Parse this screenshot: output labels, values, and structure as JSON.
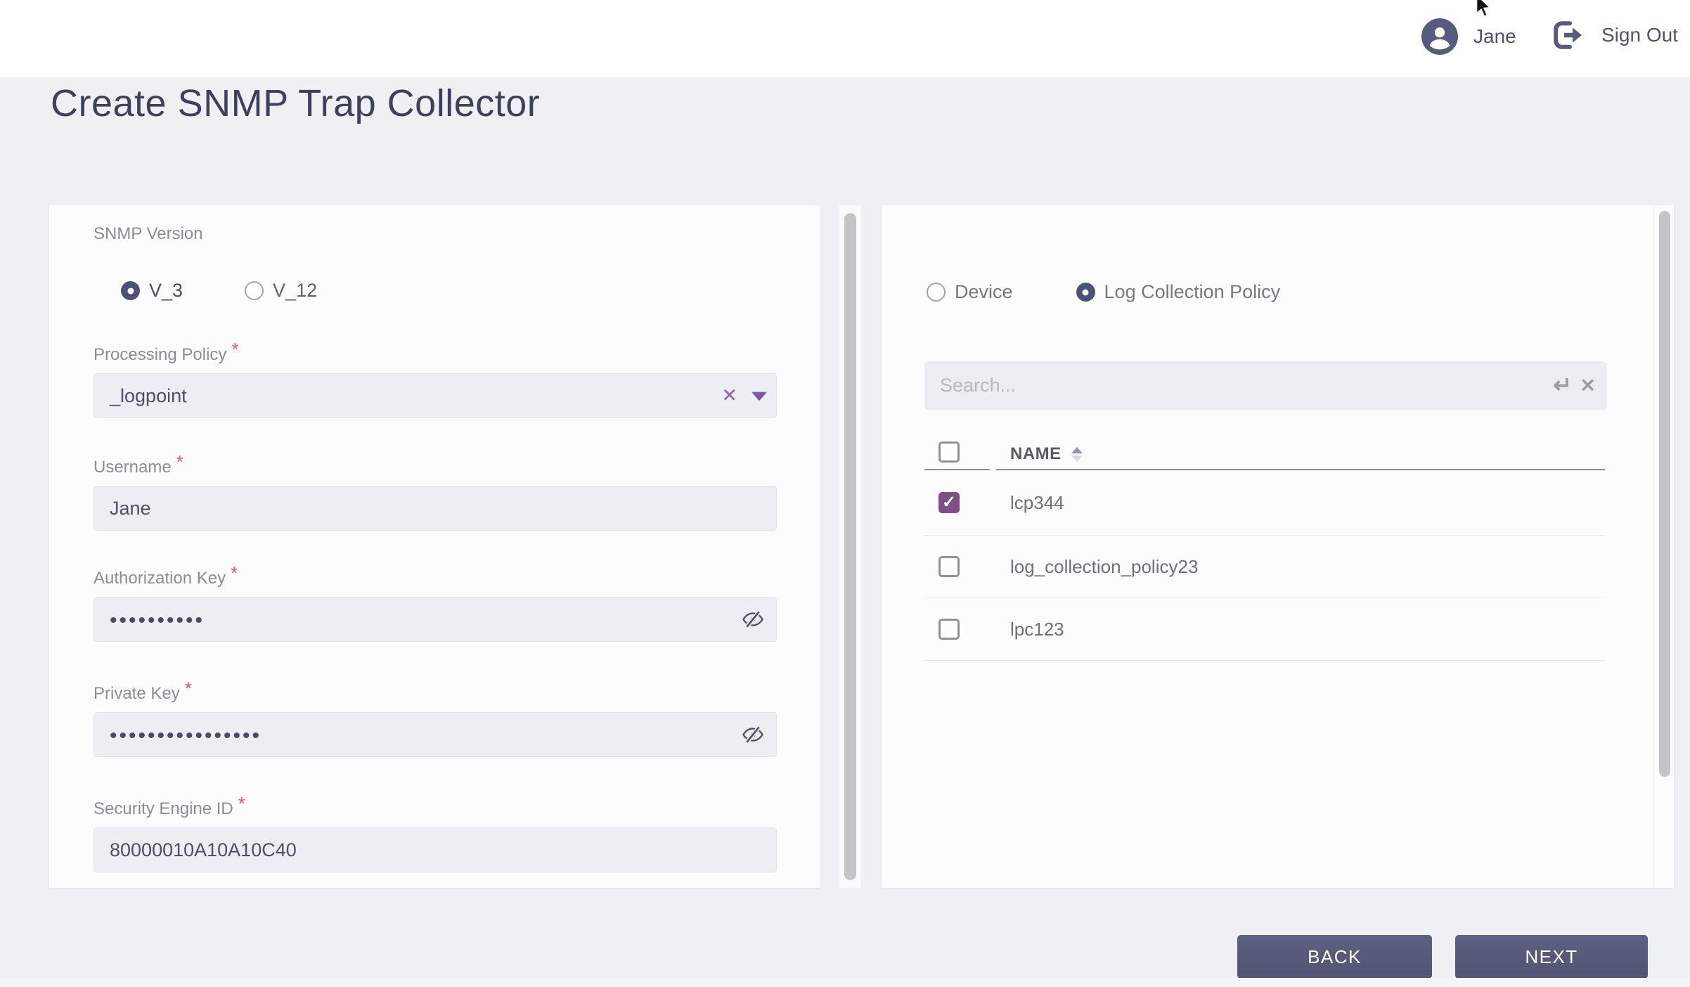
{
  "header": {
    "user_name": "Jane",
    "sign_out_label": "Sign Out"
  },
  "page": {
    "title": "Create SNMP Trap Collector"
  },
  "form": {
    "required_marker": "*",
    "snmp_version": {
      "label": "SNMP Version",
      "options": [
        {
          "label": "V_3",
          "selected": true
        },
        {
          "label": "V_12",
          "selected": false
        }
      ]
    },
    "processing_policy": {
      "label": "Processing Policy",
      "required": true,
      "value": "_logpoint"
    },
    "username": {
      "label": "Username",
      "required": true,
      "value": "Jane"
    },
    "authorization_key": {
      "label": "Authorization Key",
      "required": true,
      "masked_value": "••••••••••"
    },
    "private_key": {
      "label": "Private Key",
      "required": true,
      "masked_value": "••••••••••••••••"
    },
    "security_engine_id": {
      "label": "Security Engine ID",
      "required": true,
      "value": "80000010A10A10C40"
    }
  },
  "selector": {
    "mode_options": [
      {
        "label": "Device",
        "selected": false
      },
      {
        "label": "Log Collection Policy",
        "selected": true
      }
    ],
    "search": {
      "placeholder": "Search..."
    },
    "table": {
      "name_column_label": "NAME",
      "rows": [
        {
          "name": "lcp344",
          "checked": true
        },
        {
          "name": "log_collection_policy23",
          "checked": false
        },
        {
          "name": "lpc123",
          "checked": false
        }
      ]
    }
  },
  "footer": {
    "back_label": "BACK",
    "next_label": "NEXT"
  },
  "colors": {
    "accent_slate": "#565b7b",
    "radio_selected": "#4d5274",
    "checkbox_purple": "#7b5083",
    "icon_purple": "#7e58a5",
    "required_red": "#ee5566",
    "field_bg": "#eceef3",
    "page_bg": "#eef0f4"
  }
}
